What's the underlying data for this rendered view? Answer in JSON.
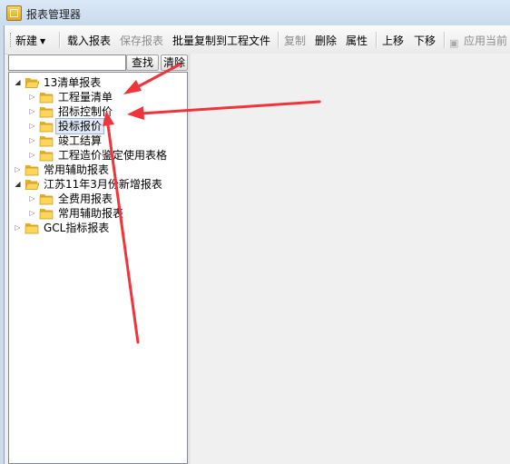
{
  "window": {
    "title": "报表管理器"
  },
  "toolbar": {
    "new": "新建",
    "load": "载入报表",
    "save": "保存报表",
    "batch_copy": "批量复制到工程文件",
    "copy": "复制",
    "delete": "删除",
    "properties": "属性",
    "move_up": "上移",
    "move_down": "下移",
    "apply": "应用当前"
  },
  "search": {
    "value": "",
    "find_label": "查找",
    "clear_label": "清除"
  },
  "tree": {
    "nodes": [
      {
        "label": "13清单报表",
        "expanded": true
      },
      {
        "label": "工程量清单"
      },
      {
        "label": "招标控制价"
      },
      {
        "label": "投标报价",
        "selected": true
      },
      {
        "label": "竣工结算"
      },
      {
        "label": "工程造价鉴定使用表格"
      },
      {
        "label": "常用辅助报表"
      },
      {
        "label": "江苏11年3月份新增报表",
        "expanded": true
      },
      {
        "label": "全费用报表"
      },
      {
        "label": "常用辅助报表"
      },
      {
        "label": "GCL指标报表"
      }
    ]
  },
  "colors": {
    "annotation_arrow": "#f0343a",
    "folder": "#f4c542"
  }
}
